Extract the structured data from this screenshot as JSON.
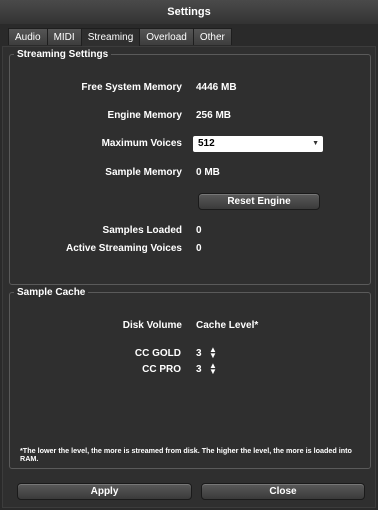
{
  "window": {
    "title": "Settings"
  },
  "tabs": [
    "Audio",
    "MIDI",
    "Streaming",
    "Overload",
    "Other"
  ],
  "streaming": {
    "legend": "Streaming Settings",
    "free_memory_label": "Free System Memory",
    "free_memory_value": "4446 MB",
    "engine_memory_label": "Engine Memory",
    "engine_memory_value": "256 MB",
    "max_voices_label": "Maximum Voices",
    "max_voices_value": "512",
    "sample_memory_label": "Sample Memory",
    "sample_memory_value": "0 MB",
    "reset_label": "Reset Engine",
    "samples_loaded_label": "Samples Loaded",
    "samples_loaded_value": "0",
    "active_voices_label": "Active Streaming Voices",
    "active_voices_value": "0"
  },
  "cache": {
    "legend": "Sample Cache",
    "disk_volume_label": "Disk Volume",
    "cache_level_label": "Cache Level*",
    "cc_gold_label": "CC GOLD",
    "cc_gold_value": "3",
    "cc_pro_label": "CC PRO",
    "cc_pro_value": "3",
    "footnote": "*The lower the level, the more is streamed from disk. The higher the level, the more is loaded into RAM."
  },
  "footer": {
    "apply_label": "Apply",
    "close_label": "Close"
  }
}
